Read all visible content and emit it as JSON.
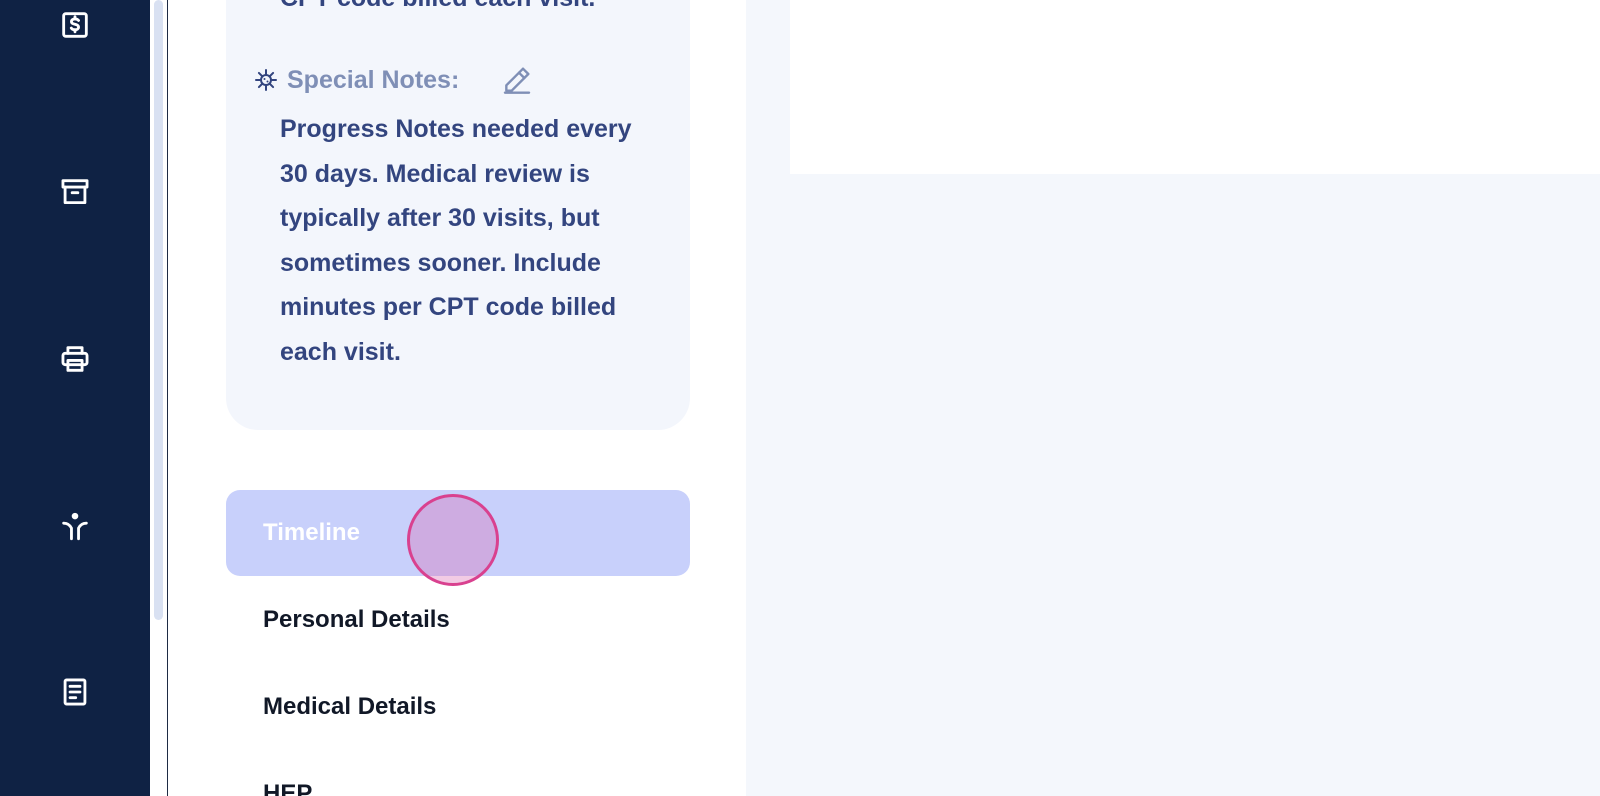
{
  "sidebar": {
    "icons": [
      {
        "name": "dollar-icon"
      },
      {
        "name": "archive-icon"
      },
      {
        "name": "printer-icon"
      },
      {
        "name": "exercise-icon"
      },
      {
        "name": "document-icon"
      }
    ]
  },
  "notes_card": {
    "truncated_top_text": "CPT code billed each visit.",
    "special_notes_label": "Special Notes:",
    "special_notes_icon": "virus-icon",
    "edit_icon": "pencil-icon",
    "special_notes_text": "Progress Notes needed every 30 days. Medical review is typically after 30 visits, but sometimes sooner. Include minutes per CPT code billed each visit."
  },
  "tabs": {
    "items": [
      {
        "label": "Timeline",
        "active": true
      },
      {
        "label": "Personal Details",
        "active": false
      },
      {
        "label": "Medical Details",
        "active": false
      },
      {
        "label": "HEP",
        "active": false
      }
    ]
  },
  "colors": {
    "sidebar_bg": "#0f2244",
    "active_tab_bg": "#c8d0fb",
    "notes_text": "#33457f",
    "label_muted": "#7f8fb6",
    "click_indicator": "#d9418f"
  }
}
